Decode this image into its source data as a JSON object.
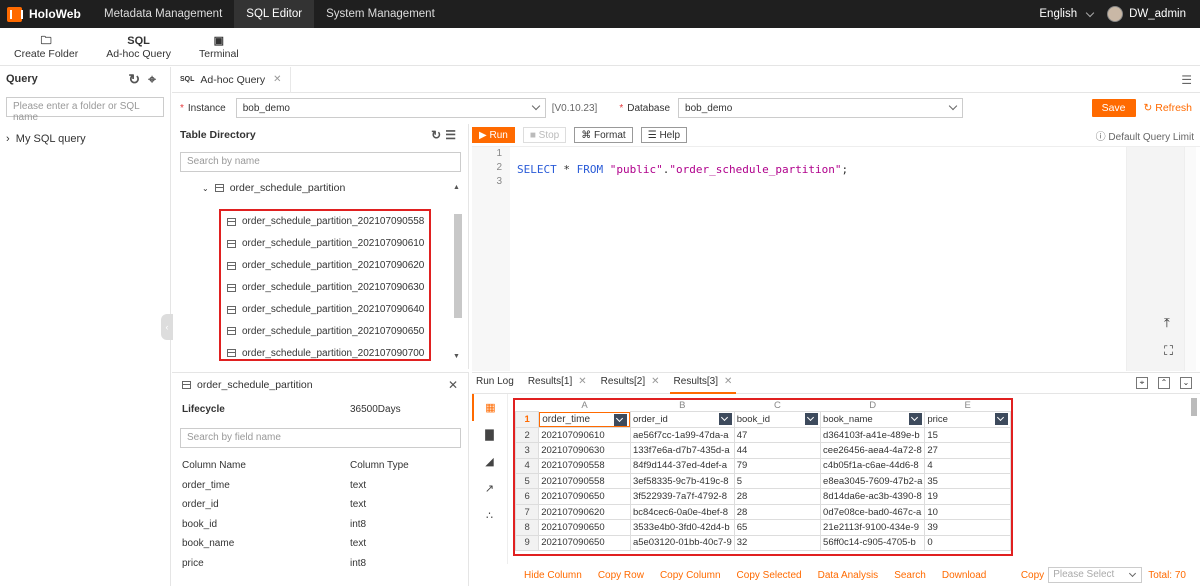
{
  "app": {
    "name": "HoloWeb"
  },
  "topnav": {
    "items": [
      "Metadata Management",
      "SQL Editor",
      "System Management"
    ],
    "active": "SQL Editor"
  },
  "topright": {
    "language": "English",
    "user": "DW_admin"
  },
  "toolbar": {
    "create_folder": "Create Folder",
    "adhoc_icon": "SQL",
    "adhoc": "Ad-hoc Query",
    "terminal": "Terminal"
  },
  "leftbar": {
    "title": "Query",
    "search_placeholder": "Please enter a folder or SQL name",
    "tree": [
      "My SQL query"
    ]
  },
  "editor_tab": {
    "icon": "SQL",
    "label": "Ad-hoc Query"
  },
  "instance": {
    "label": "Instance",
    "value": "bob_demo",
    "version": "[V0.10.23]"
  },
  "database": {
    "label": "Database",
    "value": "bob_demo"
  },
  "actions": {
    "save": "Save",
    "refresh": "Refresh"
  },
  "table_directory": {
    "title": "Table Directory",
    "search_placeholder": "Search by name",
    "parent": "order_schedule_partition",
    "children": [
      "order_schedule_partition_202107090558",
      "order_schedule_partition_202107090610",
      "order_schedule_partition_202107090620",
      "order_schedule_partition_202107090630",
      "order_schedule_partition_202107090640",
      "order_schedule_partition_202107090650",
      "order_schedule_partition_202107090700"
    ]
  },
  "details": {
    "table": "order_schedule_partition",
    "lifecycle_label": "Lifecycle",
    "lifecycle_value": "36500Days",
    "search_placeholder": "Search by field name",
    "col_name_header": "Column Name",
    "col_type_header": "Column Type",
    "columns": [
      {
        "name": "order_time",
        "type": "text"
      },
      {
        "name": "order_id",
        "type": "text"
      },
      {
        "name": "book_id",
        "type": "int8"
      },
      {
        "name": "book_name",
        "type": "text"
      },
      {
        "name": "price",
        "type": "int8"
      }
    ]
  },
  "editor": {
    "run": "Run",
    "stop": "Stop",
    "format": "Format",
    "help": "Help",
    "default_limit": "Default Query Limit",
    "lines": [
      "1",
      "2",
      "3"
    ],
    "sql_kw1": "SELECT",
    "sql_star": " * ",
    "sql_kw2": "FROM",
    "sql_s1": "\"public\"",
    "sql_dot": ".",
    "sql_s2": "\"order_schedule_partition\"",
    "sql_end": ";"
  },
  "results": {
    "tabs": [
      "Run Log",
      "Results[1]",
      "Results[2]",
      "Results[3]"
    ],
    "active_tab": "Results[3]",
    "col_letters": [
      "A",
      "B",
      "C",
      "D",
      "E"
    ],
    "headers": [
      "order_time",
      "order_id",
      "book_id",
      "book_name",
      "price"
    ],
    "rows": [
      [
        "2",
        "202107090610",
        "ae56f7cc-1a99-47da-a",
        "47",
        "d364103f-a41e-489e-b",
        "15"
      ],
      [
        "3",
        "202107090630",
        "133f7e6a-d7b7-435d-a",
        "44",
        "cee26456-aea4-4a72-8",
        "27"
      ],
      [
        "4",
        "202107090558",
        "84f9d144-37ed-4def-a",
        "79",
        "c4b05f1a-c6ae-44d6-8",
        "4"
      ],
      [
        "5",
        "202107090558",
        "3ef58335-9c7b-419c-8",
        "5",
        "e8ea3045-7609-47b2-a",
        "35"
      ],
      [
        "6",
        "202107090650",
        "3f522939-7a7f-4792-8",
        "28",
        "8d14da6e-ac3b-4390-8",
        "19"
      ],
      [
        "7",
        "202107090620",
        "bc84cec6-0a0e-4bef-8",
        "28",
        "0d7e08ce-bad0-467c-a",
        "10"
      ],
      [
        "8",
        "202107090650",
        "3533e4b0-3fd0-42d4-b",
        "65",
        "21e2113f-9100-434e-9",
        "39"
      ],
      [
        "9",
        "202107090650",
        "a5e03120-01bb-40c7-9",
        "32",
        "56ff0c14-c905-4705-b",
        "0"
      ]
    ],
    "footer_links": [
      "Hide Column",
      "Copy Row",
      "Copy Column",
      "Copy Selected",
      "Data Analysis",
      "Search",
      "Download"
    ],
    "copy_label": "Copy",
    "copy_select_placeholder": "Please Select",
    "total": "Total: 70"
  }
}
